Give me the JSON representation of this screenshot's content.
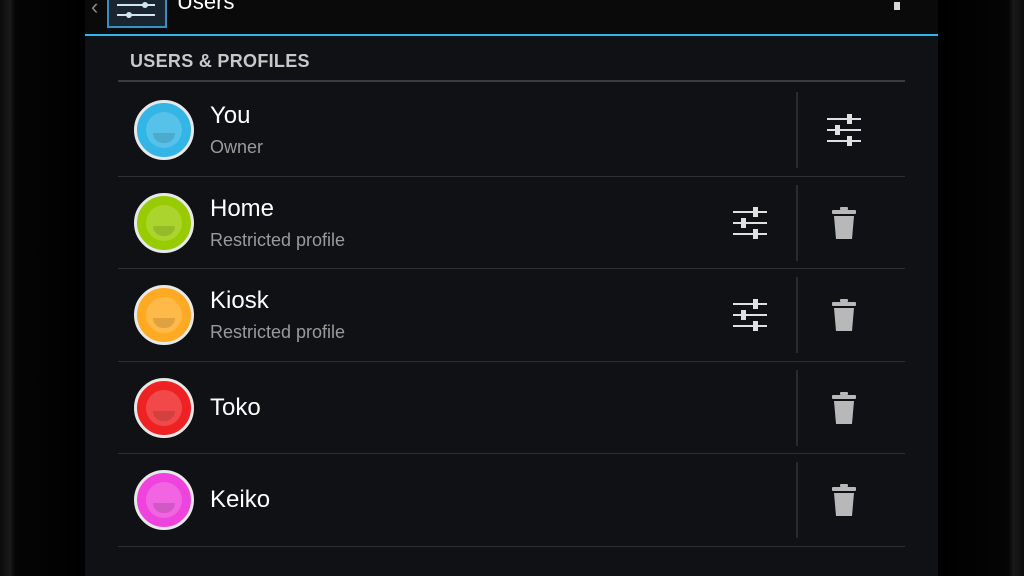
{
  "app_bar": {
    "title": "Users",
    "up_caret": "‹"
  },
  "section": {
    "header": "USERS & PROFILES"
  },
  "users": [
    {
      "name": "You",
      "subtitle": "Owner",
      "color": "#33b5e5",
      "icons": [
        "sliders-icon"
      ]
    },
    {
      "name": "Home",
      "subtitle": "Restricted profile",
      "color": "#99cc00",
      "icons": [
        "sliders-icon",
        "trash-icon"
      ]
    },
    {
      "name": "Kiosk",
      "subtitle": "Restricted profile",
      "color": "#ffaa22",
      "icons": [
        "sliders-icon",
        "trash-icon"
      ]
    },
    {
      "name": "Toko",
      "subtitle": "",
      "color": "#ee2222",
      "icons": [
        "trash-icon"
      ]
    },
    {
      "name": "Keiko",
      "subtitle": "",
      "color": "#ee44dd",
      "icons": [
        "trash-icon"
      ]
    }
  ],
  "colors": {
    "accent": "#33b5e5",
    "background": "#101114"
  }
}
